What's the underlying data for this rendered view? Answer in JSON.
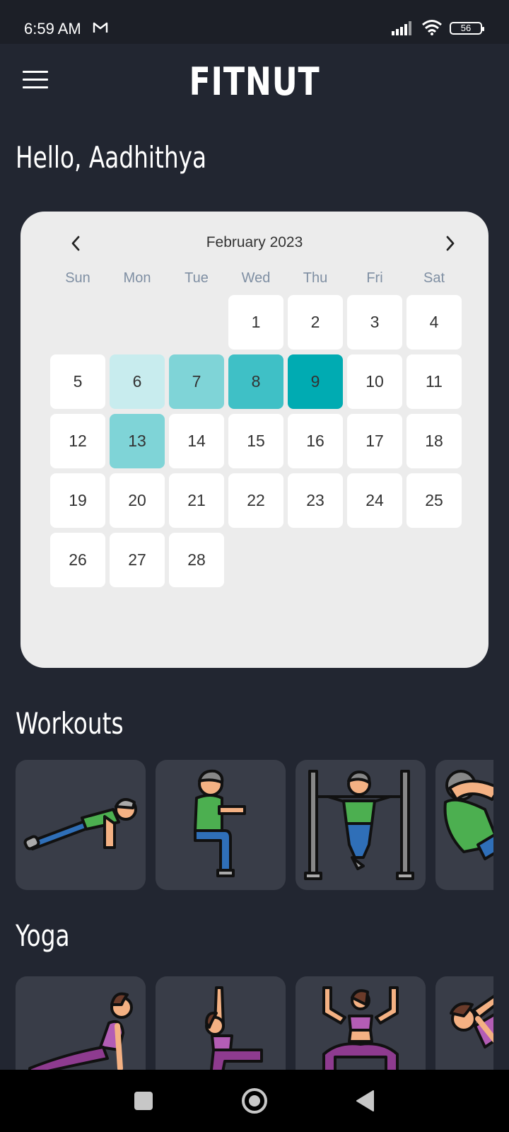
{
  "status_bar": {
    "time": "6:59 AM",
    "battery": "56"
  },
  "app": {
    "title": "FITNUT",
    "greeting": "Hello, Aadhithya"
  },
  "calendar": {
    "month": "February 2023",
    "weekdays": [
      "Sun",
      "Mon",
      "Tue",
      "Wed",
      "Thu",
      "Fri",
      "Sat"
    ],
    "leading_blanks": 3,
    "days": [
      "1",
      "2",
      "3",
      "4",
      "5",
      "6",
      "7",
      "8",
      "9",
      "10",
      "11",
      "12",
      "13",
      "14",
      "15",
      "16",
      "17",
      "18",
      "19",
      "20",
      "21",
      "22",
      "23",
      "24",
      "25",
      "26",
      "27",
      "28"
    ],
    "highlights": {
      "6": 1,
      "7": 2,
      "8": 3,
      "9": 4,
      "13": 2
    },
    "highlight_colors": [
      "#c8ecee",
      "#7fd4d7",
      "#3fc0c6",
      "#00abb2"
    ]
  },
  "sections": {
    "workouts_title": "Workouts",
    "workouts": [
      "push-up-illustration",
      "wall-sit-illustration",
      "pull-up-illustration",
      "crunch-illustration"
    ],
    "yoga_title": "Yoga",
    "yoga": [
      "cobra-pose-illustration",
      "warrior-pose-illustration",
      "goddess-pose-illustration",
      "side-stretch-illustration"
    ]
  }
}
